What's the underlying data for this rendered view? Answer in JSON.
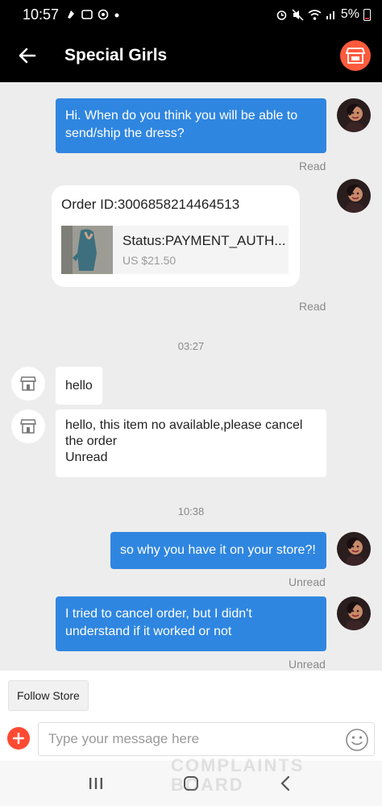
{
  "status_bar": {
    "time": "10:57",
    "battery": "5%"
  },
  "header": {
    "title": "Special Girls"
  },
  "messages": {
    "m1": {
      "text": "Hi. When do you think you will be able to send/ship the dress?",
      "status": "Read"
    },
    "order": {
      "id_text": "Order ID:3006858214464513",
      "status_text": "Status:PAYMENT_AUTH...",
      "price": "US $21.50",
      "status": "Read"
    },
    "time1": "03:27",
    "m2": {
      "text": "hello"
    },
    "m3": {
      "text": "hello, this item no available,please cancel the order",
      "unread": "Unread"
    },
    "time2": "10:38",
    "m4": {
      "text": "so why you have it on your store?!",
      "status": "Unread"
    },
    "m5": {
      "text": "I tried to cancel order, but I didn't understand if it worked or not",
      "status": "Unread"
    }
  },
  "bottom": {
    "follow_label": "Follow Store",
    "input_placeholder": "Type your message here"
  },
  "watermark": {
    "line1": "COMPLAINTS",
    "line2": "BOARD"
  },
  "icons": {
    "back": "arrow-left-icon",
    "store": "store-icon",
    "plus": "plus-icon",
    "emoji": "smiley-icon"
  },
  "colors": {
    "accent_blue": "#2f86e0",
    "brand_orange": "#ff5a3c",
    "plus_red": "#ff4a33"
  }
}
